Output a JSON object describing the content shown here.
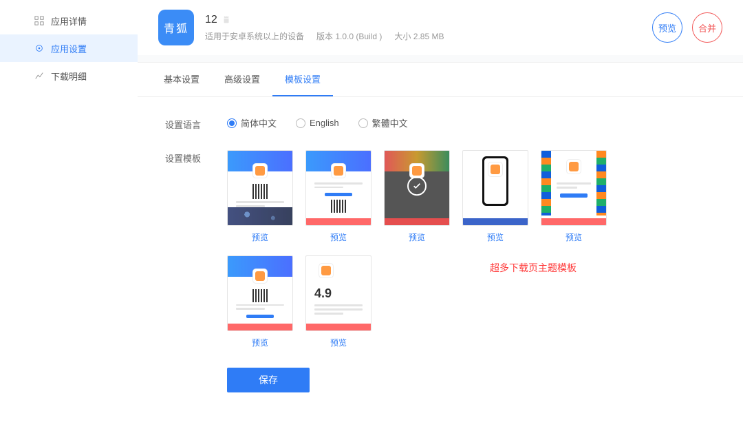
{
  "sidebar": {
    "items": [
      {
        "label": "应用详情"
      },
      {
        "label": "应用设置"
      },
      {
        "label": "下载明细"
      }
    ]
  },
  "header": {
    "app_icon_text": "青狐",
    "app_title": "12",
    "sub_device": "适用于安卓系统以上的设备",
    "version_label": "版本",
    "version_value": "1.0.0 (Build )",
    "size_label": "大小",
    "size_value": "2.85 MB",
    "btn_preview": "预览",
    "btn_merge": "合并"
  },
  "tabs": {
    "basic": "基本设置",
    "advanced": "高级设置",
    "template": "模板设置"
  },
  "lang": {
    "label": "设置语言",
    "opt_cn": "简体中文",
    "opt_en": "English",
    "opt_tc": "繁體中文"
  },
  "templates": {
    "label": "设置模板",
    "preview": "预览",
    "rating_value": "4.9"
  },
  "promo_text": "超多下载页主题模板",
  "save_btn": "保存"
}
